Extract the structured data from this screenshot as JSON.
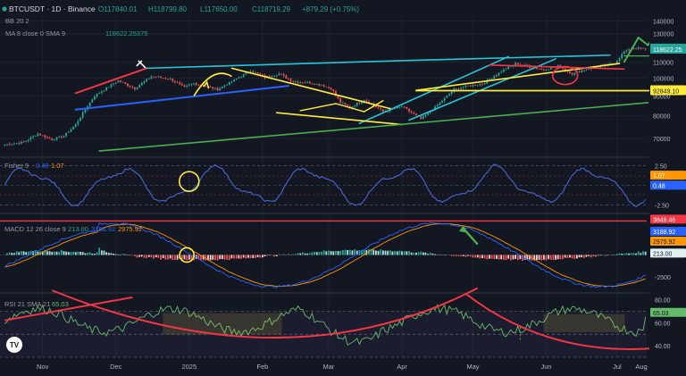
{
  "header": {
    "symbol": "BTCUSDT · 1D · Binance",
    "ohlc_o": "O117840.01",
    "ohlc_h": "H118799.80",
    "ohlc_l": "L117650.00",
    "ohlc_c": "C118719.29",
    "change": "+879.29 (+0.75%)",
    "bb_label": "BB 20 2",
    "ma_label": "MA 8 close 0 SMA 9",
    "ma_value": "118622.25375"
  },
  "colors": {
    "background": "#131722",
    "up": "#26a69a",
    "down": "#ef5350",
    "cyan": "#26c6da",
    "yellow": "#ffeb3b",
    "red": "#f23645",
    "green": "#4caf50",
    "blue": "#2962ff",
    "orange": "#ff9800",
    "rsi_line": "#66bb6a"
  },
  "chart_data": [
    {
      "type": "candlestick",
      "title": "BTCUSDT · 1D · Binance",
      "x_ticks": [
        "Nov",
        "Dec",
        "2025",
        "Feb",
        "Mar",
        "Apr",
        "May",
        "Jun",
        "Jul",
        "Aug"
      ],
      "y_ticks": [
        70000,
        80000,
        90000,
        100000,
        110000,
        130000,
        140000
      ],
      "ylim": [
        63000,
        145000
      ],
      "scale": "log",
      "price_labels": [
        {
          "value": 118719.29,
          "label": "118719.29",
          "color": "#26a69a"
        },
        {
          "value": 118622.25,
          "label": "118622.25",
          "color": "#26a69a"
        },
        {
          "value": 92849.1,
          "label": "92849.10",
          "color": "#ffeb3b"
        }
      ],
      "monthly_closes": [
        {
          "month": "Oct",
          "close": 70200
        },
        {
          "month": "Nov",
          "close": 96400
        },
        {
          "month": "Dec",
          "close": 93400
        },
        {
          "month": "Jan",
          "close": 102400
        },
        {
          "month": "Feb",
          "close": 84300
        },
        {
          "month": "Mar",
          "close": 82500
        },
        {
          "month": "Apr",
          "close": 94200
        },
        {
          "month": "May",
          "close": 104600
        },
        {
          "month": "Jun",
          "close": 107100
        },
        {
          "month": "Jul",
          "close": 118719
        }
      ],
      "horizontal_support": 92849.1
    },
    {
      "type": "line",
      "title": "Fisher 9",
      "series": [
        {
          "name": "Fisher",
          "last": 0.48
        },
        {
          "name": "Trigger",
          "last": 1.07
        }
      ],
      "y_ticks": [
        2.5,
        0.0,
        -2.5
      ],
      "value_labels": [
        "1.07",
        "0.48"
      ]
    },
    {
      "type": "bar",
      "title": "MACD 12 26 close 9",
      "series": [
        {
          "name": "Histogram",
          "last": 213.0
        },
        {
          "name": "MACD",
          "last": 3188.92
        },
        {
          "name": "Signal",
          "last": 2975.92
        }
      ],
      "y_ticks": [
        2500,
        0,
        -2500
      ],
      "value_labels": [
        "3848.46",
        "3188.92",
        "2975.92",
        "213.00"
      ],
      "horizontal_level": 3848.46
    },
    {
      "type": "line",
      "title": "RSI 21 SMA 21",
      "series": [
        {
          "name": "RSI",
          "last": 65.03
        }
      ],
      "y_ticks": [
        80.0,
        60.0,
        40.0
      ],
      "value_labels": [
        "65.03"
      ]
    }
  ],
  "annotations": {
    "watermark": "TV"
  }
}
